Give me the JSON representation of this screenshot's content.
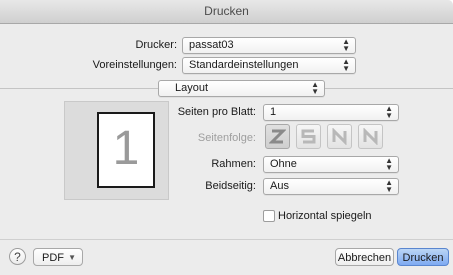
{
  "window": {
    "title": "Drucken"
  },
  "printer": {
    "label": "Drucker:",
    "value": "passat03"
  },
  "presets": {
    "label": "Voreinstellungen:",
    "value": "Standardeinstellungen"
  },
  "section": {
    "value": "Layout"
  },
  "preview": {
    "page_number": "1"
  },
  "layout": {
    "pages_per_sheet": {
      "label": "Seiten pro Blatt:",
      "value": "1"
    },
    "page_order": {
      "label": "Seitenfolge:",
      "icons": [
        "order-z-icon",
        "order-s-icon",
        "order-n-reverse-icon",
        "order-n-icon"
      ],
      "selected": 0
    },
    "border": {
      "label": "Rahmen:",
      "value": "Ohne"
    },
    "two_sided": {
      "label": "Beidseitig:",
      "value": "Aus"
    },
    "flip_horizontal": {
      "label": "Horizontal spiegeln",
      "checked": false
    }
  },
  "footer": {
    "help_label": "?",
    "pdf_label": "PDF",
    "cancel_label": "Abbrechen",
    "print_label": "Drucken"
  },
  "colors": {
    "default_button": "#7eaaf2",
    "background": "#ececec"
  }
}
